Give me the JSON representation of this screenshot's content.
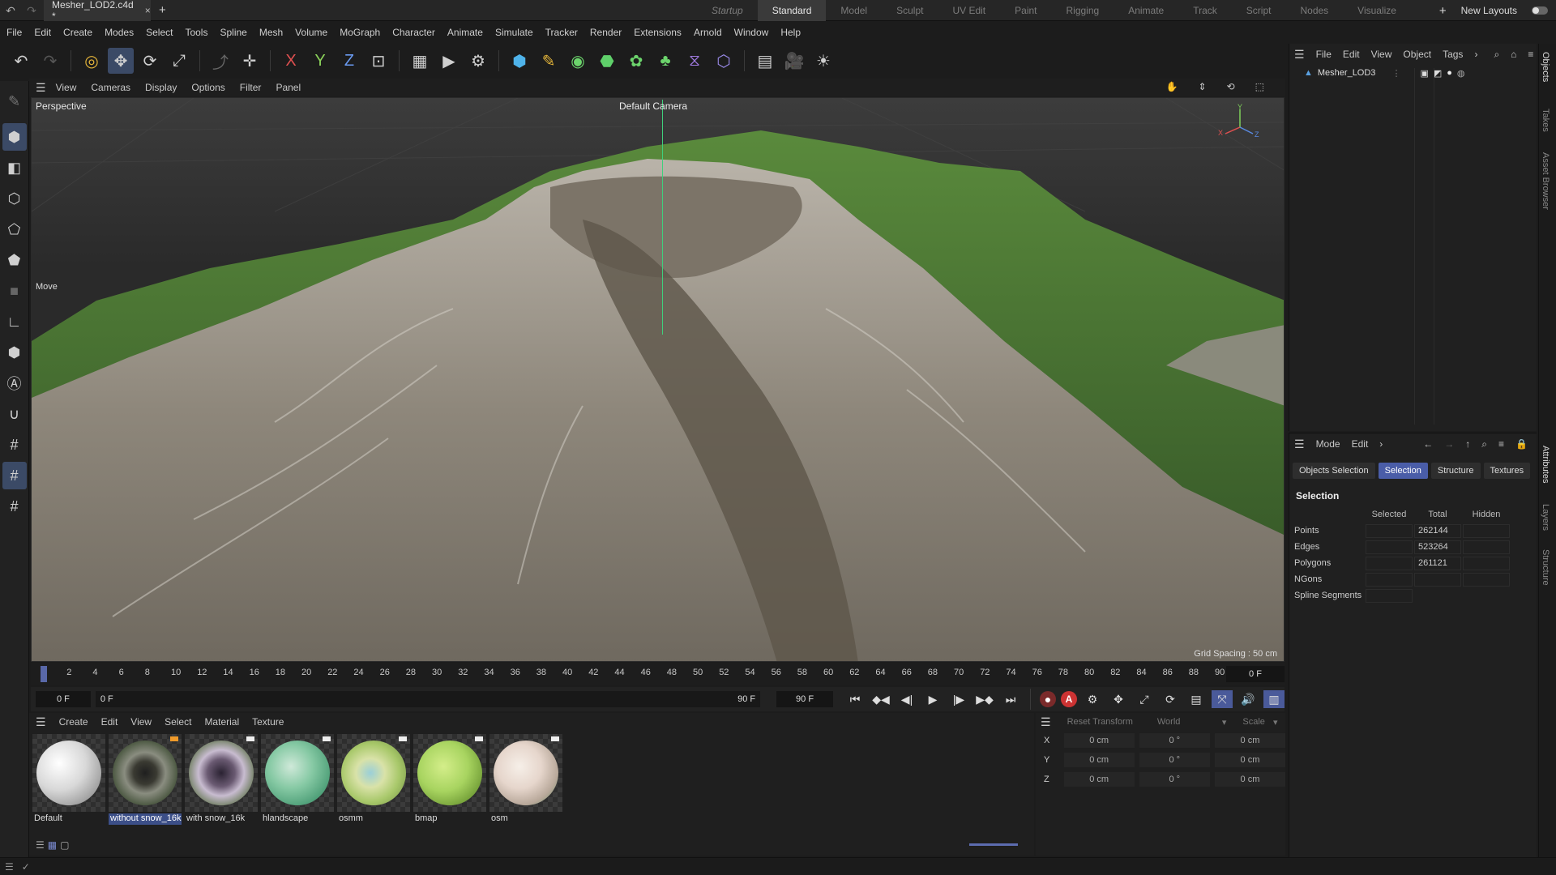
{
  "titlebar": {
    "doc_tab": "Mesher_LOD2.c4d *",
    "layouts": [
      {
        "label": "Startup",
        "state": "italic"
      },
      {
        "label": "Standard",
        "state": "active"
      },
      {
        "label": "Model",
        "state": ""
      },
      {
        "label": "Sculpt",
        "state": ""
      },
      {
        "label": "UV Edit",
        "state": ""
      },
      {
        "label": "Paint",
        "state": ""
      },
      {
        "label": "Rigging",
        "state": ""
      },
      {
        "label": "Animate",
        "state": ""
      },
      {
        "label": "Track",
        "state": ""
      },
      {
        "label": "Script",
        "state": ""
      },
      {
        "label": "Nodes",
        "state": ""
      },
      {
        "label": "Visualize",
        "state": ""
      }
    ],
    "new_layouts": "New Layouts"
  },
  "menubar": [
    "File",
    "Edit",
    "Create",
    "Modes",
    "Select",
    "Tools",
    "Spline",
    "Mesh",
    "Volume",
    "MoGraph",
    "Character",
    "Animate",
    "Simulate",
    "Tracker",
    "Render",
    "Extensions",
    "Arnold",
    "Window",
    "Help"
  ],
  "viewport": {
    "menu": [
      "View",
      "Cameras",
      "Display",
      "Options",
      "Filter",
      "Panel"
    ],
    "label": "Perspective",
    "camera": "Default Camera",
    "tool_label": "Move",
    "grid_spacing": "Grid Spacing : 50 cm",
    "axis_x": "X",
    "axis_y": "Y",
    "axis_z": "Z"
  },
  "timeline": {
    "ticks": [
      "0",
      "2",
      "4",
      "6",
      "8",
      "10",
      "12",
      "14",
      "16",
      "18",
      "20",
      "22",
      "24",
      "26",
      "28",
      "30",
      "32",
      "34",
      "36",
      "38",
      "40",
      "42",
      "44",
      "46",
      "48",
      "50",
      "52",
      "54",
      "56",
      "58",
      "60",
      "62",
      "64",
      "66",
      "68",
      "70",
      "72",
      "74",
      "76",
      "78",
      "80",
      "82",
      "84",
      "86",
      "88",
      "90"
    ],
    "current_frame": "0 F",
    "start": "0 F",
    "range_start": "0 F",
    "range_end": "90 F",
    "end": "90 F"
  },
  "materials": {
    "menu": [
      "Create",
      "Edit",
      "View",
      "Select",
      "Material",
      "Texture"
    ],
    "items": [
      {
        "name": "Default",
        "style": "default",
        "flag": "",
        "selected": false
      },
      {
        "name": "without snow_16k",
        "style": "dark",
        "flag": "orange",
        "selected": true
      },
      {
        "name": "with snow_16k",
        "style": "purple",
        "flag": "white",
        "selected": false
      },
      {
        "name": "hlandscape",
        "style": "mint",
        "flag": "white",
        "selected": false
      },
      {
        "name": "osmm",
        "style": "lime-mix",
        "flag": "white",
        "selected": false
      },
      {
        "name": "bmap",
        "style": "lime",
        "flag": "white",
        "selected": false
      },
      {
        "name": "osm",
        "style": "cream",
        "flag": "white",
        "selected": false
      }
    ]
  },
  "coords": {
    "reset": "Reset Transform",
    "space": "World",
    "mode": "Scale",
    "rows": [
      {
        "axis": "X",
        "pos": "0 cm",
        "rot": "0 °",
        "scale": "0 cm"
      },
      {
        "axis": "Y",
        "pos": "0 cm",
        "rot": "0 °",
        "scale": "0 cm"
      },
      {
        "axis": "Z",
        "pos": "0 cm",
        "rot": "0 °",
        "scale": "0 cm"
      }
    ]
  },
  "objects": {
    "menu": [
      "File",
      "Edit",
      "View",
      "Object",
      "Tags"
    ],
    "item": "Mesher_LOD3"
  },
  "attributes": {
    "menu": [
      "Mode",
      "Edit"
    ],
    "tabs": [
      {
        "label": "Objects Selection",
        "active": false
      },
      {
        "label": "Selection",
        "active": true
      },
      {
        "label": "Structure",
        "active": false
      },
      {
        "label": "Textures",
        "active": false
      }
    ],
    "section": "Selection",
    "headers": [
      "Selected",
      "Total",
      "Hidden"
    ],
    "rows": [
      {
        "label": "Points",
        "selected": "",
        "total": "262144",
        "hidden": ""
      },
      {
        "label": "Edges",
        "selected": "",
        "total": "523264",
        "hidden": ""
      },
      {
        "label": "Polygons",
        "selected": "",
        "total": "261121",
        "hidden": ""
      },
      {
        "label": "NGons",
        "selected": "",
        "total": "",
        "hidden": ""
      },
      {
        "label": "Spline Segments",
        "selected": "",
        "total": null,
        "hidden": null
      }
    ]
  },
  "side_tabs": [
    "Objects",
    "Takes",
    "Asset Browser",
    "Attributes",
    "Layers",
    "Structure"
  ]
}
